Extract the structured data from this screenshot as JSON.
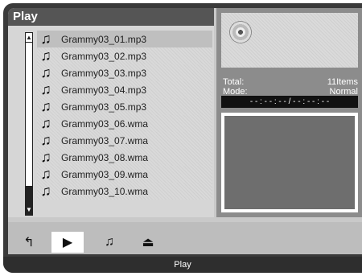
{
  "title": "Play",
  "files": [
    "Grammy03_01.mp3",
    "Grammy03_02.mp3",
    "Grammy03_03.mp3",
    "Grammy03_04.mp3",
    "Grammy03_05.mp3",
    "Grammy03_06.wma",
    "Grammy03_07.wma",
    "Grammy03_08.wma",
    "Grammy03_09.wma",
    "Grammy03_10.wma"
  ],
  "info": {
    "total_label": "Total:",
    "total_value": "11Items",
    "mode_label": "Mode:",
    "mode_value": "Normal",
    "time": "- - : - - : - - / - - : - - : - -"
  },
  "toolbar": {
    "up_icon": "↰",
    "play_icon": "▶",
    "music_icon": "♫",
    "eject_icon": "⏏"
  },
  "status": "Play"
}
